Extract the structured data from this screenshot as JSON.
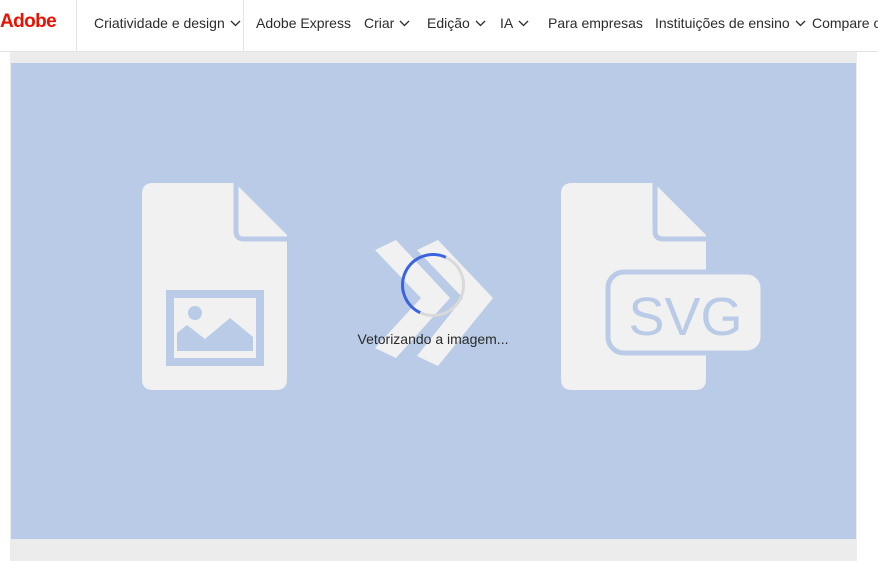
{
  "brand": {
    "logo_text": "Adobe",
    "color": "#eb1000"
  },
  "nav": {
    "items": [
      {
        "label": "Criatividade e design",
        "has_dropdown": true
      },
      {
        "label": "Adobe Express",
        "has_dropdown": false
      },
      {
        "label": "Criar",
        "has_dropdown": true
      },
      {
        "label": "Edição",
        "has_dropdown": true
      },
      {
        "label": "IA",
        "has_dropdown": true
      },
      {
        "label": "Para empresas",
        "has_dropdown": false
      },
      {
        "label": "Instituições de ensino",
        "has_dropdown": true
      },
      {
        "label": "Compare os",
        "has_dropdown": false
      }
    ]
  },
  "converter": {
    "source_icon": "image-file-icon",
    "arrow_icon": "double-chevron-right-icon",
    "target_icon": "svg-file-icon",
    "target_badge_text": "SVG",
    "status_text": "Vetorizando a imagem...",
    "spinner_accent": "#3b63e0",
    "stage_color": "#b9cbe7",
    "icon_color": "#f1f1f1"
  }
}
